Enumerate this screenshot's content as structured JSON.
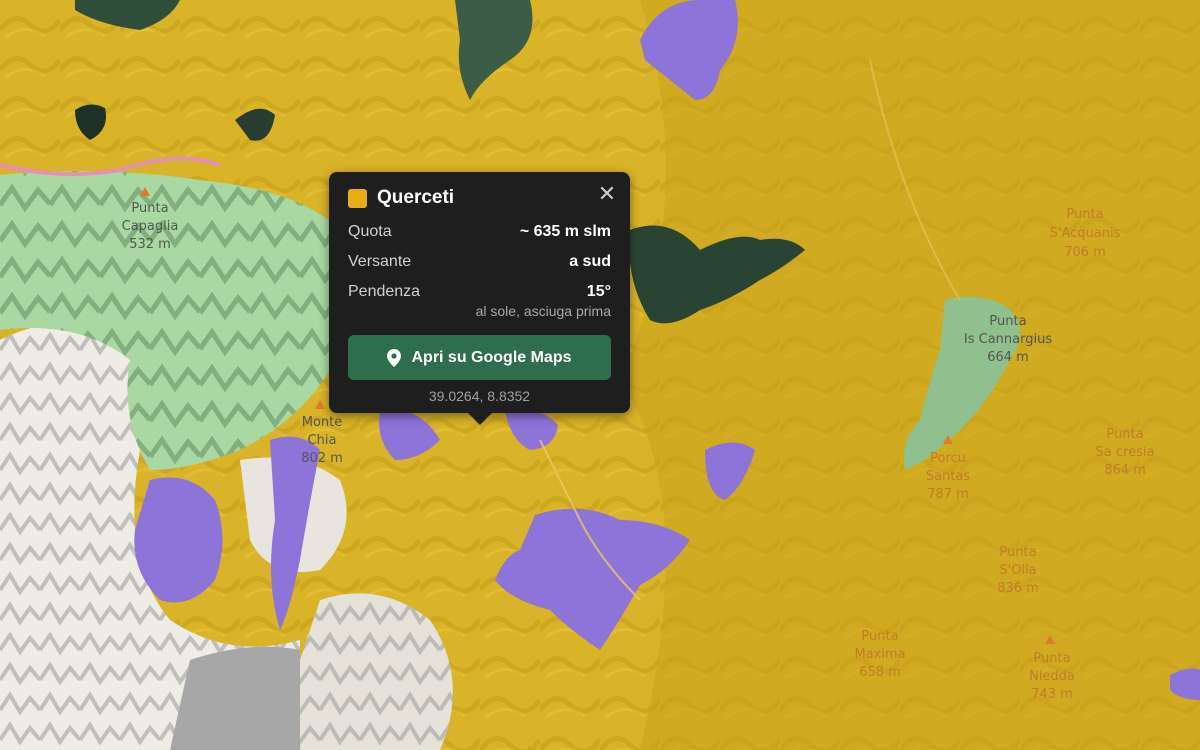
{
  "colors": {
    "oak": "#e8ad12",
    "purple": "#8e73d8",
    "green": "#a8d9a4",
    "popup_bg": "#1e1e1e",
    "button": "#2f6e4d"
  },
  "map_labels": [
    {
      "id": "capaglia",
      "text": "Punta"
    },
    {
      "id": "capaglia2",
      "text": "Capaglia"
    },
    {
      "id": "capaglia_h",
      "text": "532 m"
    },
    {
      "id": "chia",
      "text": "Monte"
    },
    {
      "id": "chia2",
      "text": "Chia"
    },
    {
      "id": "chia_h",
      "text": "802 m"
    },
    {
      "id": "acquanis",
      "text": "Punta"
    },
    {
      "id": "acquanis2",
      "text": "S'Acquanis"
    },
    {
      "id": "acquanis_h",
      "text": "706 m"
    },
    {
      "id": "cannargius",
      "text": "Punta"
    },
    {
      "id": "cannargius2",
      "text": "Is Cannargius"
    },
    {
      "id": "cannargius_h",
      "text": "664 m"
    },
    {
      "id": "santas",
      "text": "Porcu"
    },
    {
      "id": "santas2",
      "text": "Santas"
    },
    {
      "id": "santas_h",
      "text": "787 m"
    },
    {
      "id": "sacresia",
      "text": "Punta"
    },
    {
      "id": "sacresia2",
      "text": "Sa cresia"
    },
    {
      "id": "sacresia_h",
      "text": "864 m"
    },
    {
      "id": "solla",
      "text": "Punta"
    },
    {
      "id": "solla2",
      "text": "S'Olla"
    },
    {
      "id": "solla_h",
      "text": "836 m"
    },
    {
      "id": "maxima",
      "text": "Punta"
    },
    {
      "id": "maxima2",
      "text": "Maxima"
    },
    {
      "id": "maxima_h",
      "text": "658 m"
    },
    {
      "id": "niedda",
      "text": "Punta"
    },
    {
      "id": "niedda2",
      "text": "Niedda"
    },
    {
      "id": "niedda_h",
      "text": "743 m"
    }
  ],
  "popup": {
    "title": "Querceti",
    "close_icon": "close-icon",
    "rows": [
      {
        "label": "Quota",
        "value": "~ 635 m slm"
      },
      {
        "label": "Versante",
        "value": "a sud"
      },
      {
        "label": "Pendenza",
        "value": "15°"
      }
    ],
    "note": "al sole, asciuga prima",
    "button_icon": "map-pin-icon",
    "button_label": "Apri su Google Maps",
    "coords": "39.0264, 8.8352"
  }
}
